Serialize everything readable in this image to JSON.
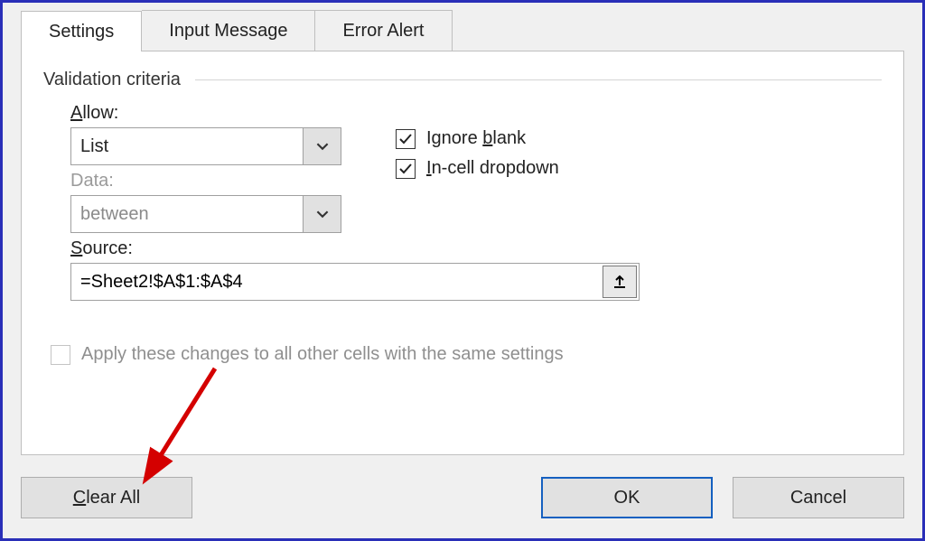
{
  "tabs": {
    "settings": "Settings",
    "input_message": "Input Message",
    "error_alert": "Error Alert"
  },
  "group": {
    "title": "Validation criteria"
  },
  "allow": {
    "label_pre": "A",
    "label_post": "llow:",
    "value": "List"
  },
  "data": {
    "label": "Data:",
    "value": "between"
  },
  "checks": {
    "ignore_pre": "Ignore ",
    "ignore_u": "b",
    "ignore_post": "lank",
    "ignore_checked": true,
    "incell_u": "I",
    "incell_post": "n-cell dropdown",
    "incell_checked": true
  },
  "source": {
    "label_u": "S",
    "label_post": "ource:",
    "value": "=Sheet2!$A$1:$A$4"
  },
  "apply": {
    "label": "Apply these changes to all other cells with the same settings",
    "checked": false
  },
  "buttons": {
    "clear_u": "C",
    "clear_post": "lear All",
    "ok": "OK",
    "cancel": "Cancel"
  }
}
